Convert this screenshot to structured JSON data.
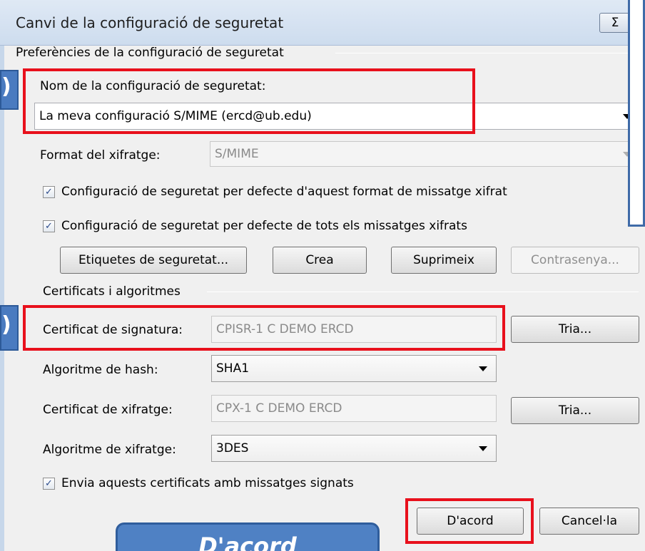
{
  "dialog": {
    "title": "Canvi de la configuració de seguretat",
    "close_label": "Σ"
  },
  "preferences": {
    "group_label": "Preferències de la configuració de seguretat",
    "name_label": "Nom de la configuració de seguretat:",
    "name_value": "La meva configuració S/MIME (ercd@ub.edu)",
    "format_label": "Format del xifratge:",
    "format_value": "S/MIME",
    "default_format_check": "Configuració de seguretat per defecte d'aquest format de missatge xifrat",
    "default_all_check": "Configuració de seguretat per defecte de tots els missatges xifrats",
    "buttons": {
      "labels": "Etiquetes de seguretat...",
      "create": "Crea",
      "delete": "Suprimeix",
      "password": "Contrasenya..."
    }
  },
  "certificates": {
    "group_label": "Certificats i algoritmes",
    "signing_label": "Certificat de signatura:",
    "signing_value": "CPISR-1 C DEMO ERCD",
    "choose_signing": "Tria...",
    "hash_label": "Algoritme de hash:",
    "hash_value": "SHA1",
    "encryption_label": "Certificat de xifratge:",
    "encryption_value": "CPX-1 C DEMO ERCD",
    "choose_encryption": "Tria...",
    "enc_algo_label": "Algoritme de xifratge:",
    "enc_algo_value": "3DES",
    "send_certs_check": "Envia aquests certificats amb missatges signats"
  },
  "footer": {
    "ok": "D'acord",
    "cancel": "Cancel·la"
  },
  "annotations": {
    "marker_1": ")",
    "marker_2": ")",
    "callout_text": "D'acord",
    "checkmark": "✓",
    "accent_red": "#e8101c",
    "callout_blue": "#4a7bc0"
  }
}
